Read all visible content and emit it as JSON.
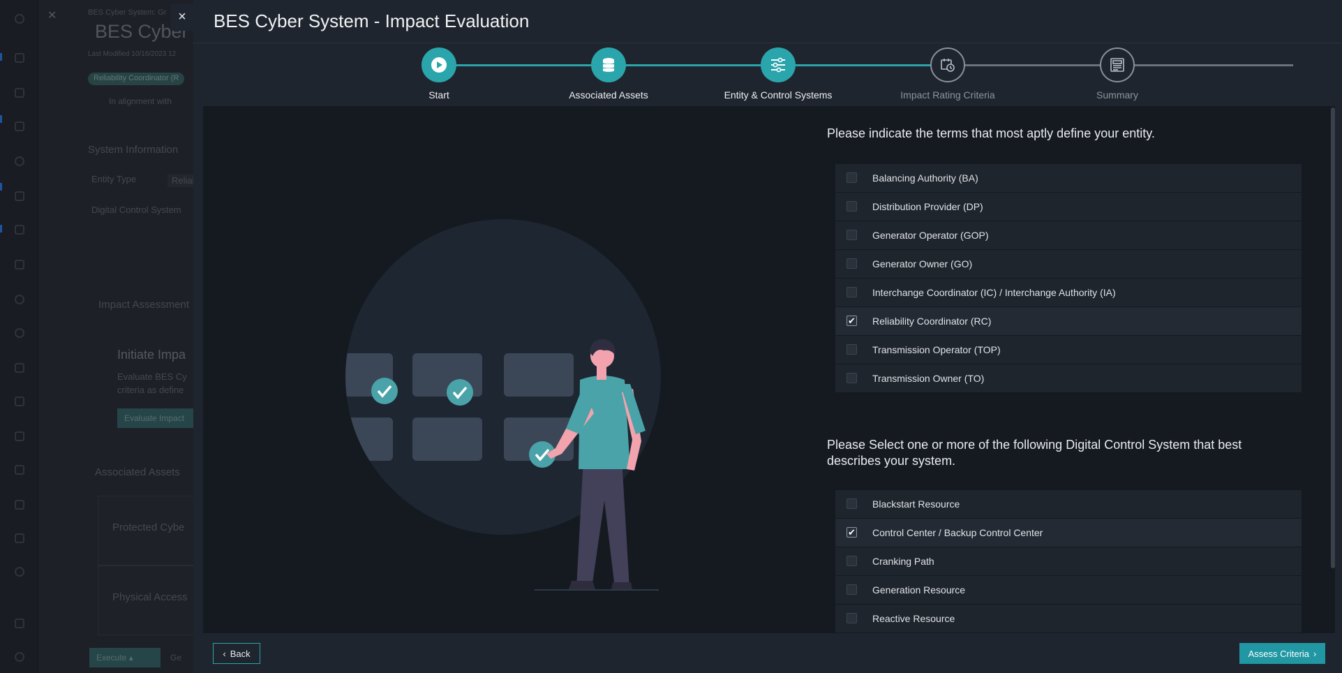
{
  "background_app": {
    "breadcrumb": "BES Cyber System: Gr",
    "title": "BES Cyber S",
    "last_modified": "Last Modified 10/16/2023 12",
    "badge": "Reliability Coordinator (R",
    "bullet": "In alignment with",
    "system_info": "System Information",
    "entity_type_label": "Entity Type",
    "entity_type_value": "Reliab",
    "digital_control_label": "Digital Control System",
    "impact_assessment": "Impact Assessment",
    "initiate_heading": "Initiate Impa",
    "initiate_text_1": "Evaluate BES Cy",
    "initiate_text_2": "criteria as define",
    "evaluate_button": "Evaluate Impact",
    "associated_assets": "Associated Assets",
    "card_1": "Protected Cybe",
    "card_2": "Physical Access",
    "execute_button": "Execute",
    "execute_partial": "Ge"
  },
  "modal": {
    "title": "BES Cyber System - Impact Evaluation",
    "close_label": "×",
    "steps": [
      {
        "label": "Start",
        "state": "done",
        "icon": "play-icon"
      },
      {
        "label": "Associated Assets",
        "state": "done",
        "icon": "database-icon"
      },
      {
        "label": "Entity & Control Systems",
        "state": "done",
        "icon": "sliders-icon"
      },
      {
        "label": "Impact Rating Criteria",
        "state": "todo",
        "icon": "calendar-clock-icon"
      },
      {
        "label": "Summary",
        "state": "todo",
        "icon": "document-list-icon"
      }
    ],
    "entity_question": "Please indicate the terms that most aptly define your entity.",
    "entity_options": [
      {
        "label": "Balancing Authority (BA)",
        "checked": false
      },
      {
        "label": "Distribution Provider (DP)",
        "checked": false
      },
      {
        "label": "Generator Operator (GOP)",
        "checked": false
      },
      {
        "label": "Generator Owner (GO)",
        "checked": false
      },
      {
        "label": "Interchange Coordinator (IC) / Interchange Authority (IA)",
        "checked": false
      },
      {
        "label": "Reliability Coordinator (RC)",
        "checked": true
      },
      {
        "label": "Transmission Operator (TOP)",
        "checked": false
      },
      {
        "label": "Transmission Owner (TO)",
        "checked": false
      }
    ],
    "dcs_question": "Please Select one or more of the following Digital Control System that best describes your system.",
    "dcs_options": [
      {
        "label": "Blackstart Resource",
        "checked": false
      },
      {
        "label": "Control Center / Backup Control Center",
        "checked": true
      },
      {
        "label": "Cranking Path",
        "checked": false
      },
      {
        "label": "Generation Resource",
        "checked": false
      },
      {
        "label": "Reactive Resource",
        "checked": false
      }
    ],
    "back_label": "Back",
    "assess_label": "Assess Criteria",
    "colors": {
      "accent": "#2ba5ac",
      "primary_button": "#2097a3",
      "modal_bg": "#1f252e",
      "body_bg": "#151a21"
    }
  }
}
